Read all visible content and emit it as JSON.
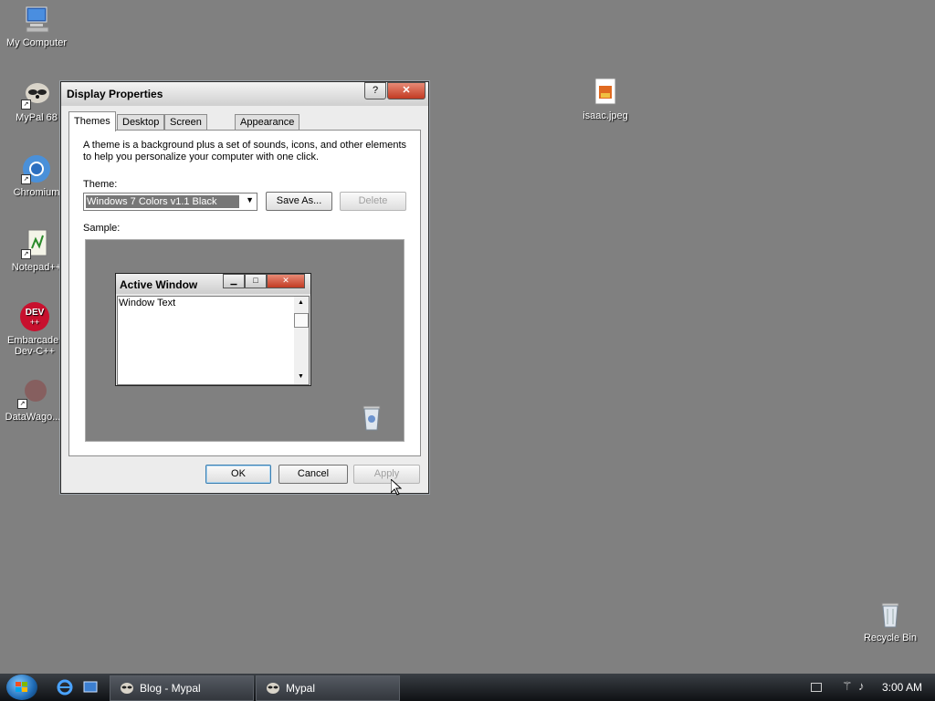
{
  "desktop": {
    "icons": [
      {
        "label": "My Computer",
        "icon": "computer-icon"
      },
      {
        "label": "MyPal 68",
        "icon": "mypal-icon"
      },
      {
        "label": "Chromium",
        "icon": "chromium-icon"
      },
      {
        "label": "Notepad++",
        "icon": "notepad-plus-plus-icon"
      },
      {
        "label_line1": "Embarcader",
        "label_line2": "Dev-C++",
        "icon": "devcpp-icon"
      },
      {
        "label": "DataWago...",
        "icon": "datawago-icon"
      },
      {
        "label": "isaac.jpeg",
        "icon": "image-file-icon"
      },
      {
        "label": "Recycle Bin",
        "icon": "recycle-bin-icon"
      }
    ]
  },
  "dialog": {
    "title": "Display Properties",
    "help_glyph": "?",
    "close_glyph": "✕",
    "tabs": [
      "Themes",
      "Desktop",
      "Screen Saver",
      "Appearance"
    ],
    "active_tab": "Themes",
    "description": "A theme is a background plus a set of sounds, icons, and other elements to help you personalize your computer with one click.",
    "theme_label": "Theme:",
    "theme_value": "Windows 7 Colors v1.1 Black",
    "save_as_label": "Save As...",
    "delete_label": "Delete",
    "sample_label": "Sample:",
    "sample": {
      "window_title": "Active Window",
      "window_text": "Window Text"
    },
    "ok_label": "OK",
    "cancel_label": "Cancel",
    "apply_label": "Apply"
  },
  "taskbar": {
    "tasks": [
      {
        "label": "Blog - Mypal",
        "icon": "mypal-icon"
      },
      {
        "label": "Mypal",
        "icon": "mypal-icon"
      }
    ],
    "clock": "3:00 AM"
  },
  "colors": {
    "desktop_bg": "#808080",
    "selection": "#777777",
    "close_button": "#c23b23"
  }
}
